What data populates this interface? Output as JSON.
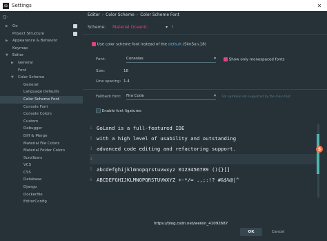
{
  "window": {
    "title": "Settings"
  },
  "sidebar": {
    "search_placeholder": "Q-",
    "items": [
      {
        "label": "Go",
        "indent": 0,
        "arrow": "▶",
        "gear": true
      },
      {
        "label": "Project Structure",
        "indent": 0,
        "arrow": "",
        "gear": true
      },
      {
        "label": "Appearance & Behavior",
        "indent": 0,
        "arrow": "▶",
        "gear": false
      },
      {
        "label": "Keymap",
        "indent": 0,
        "arrow": "",
        "gear": false
      },
      {
        "label": "Editor",
        "indent": 0,
        "arrow": "▼",
        "gear": false
      },
      {
        "label": "General",
        "indent": 1,
        "arrow": "▶",
        "gear": false
      },
      {
        "label": "Font",
        "indent": 1,
        "arrow": "",
        "gear": false
      },
      {
        "label": "Color Scheme",
        "indent": 1,
        "arrow": "▼",
        "gear": false
      },
      {
        "label": "General",
        "indent": 2,
        "arrow": "",
        "gear": false
      },
      {
        "label": "Language Defaults",
        "indent": 2,
        "arrow": "",
        "gear": false
      },
      {
        "label": "Color Scheme Font",
        "indent": 2,
        "arrow": "",
        "gear": false,
        "selected": true
      },
      {
        "label": "Console Font",
        "indent": 2,
        "arrow": "",
        "gear": false
      },
      {
        "label": "Console Colors",
        "indent": 2,
        "arrow": "",
        "gear": false
      },
      {
        "label": "Custom",
        "indent": 2,
        "arrow": "",
        "gear": false
      },
      {
        "label": "Debugger",
        "indent": 2,
        "arrow": "",
        "gear": false
      },
      {
        "label": "Diff & Merge",
        "indent": 2,
        "arrow": "",
        "gear": false
      },
      {
        "label": "Material File Colors",
        "indent": 2,
        "arrow": "",
        "gear": false
      },
      {
        "label": "Material Folder Colors",
        "indent": 2,
        "arrow": "",
        "gear": false
      },
      {
        "label": "Scrollbars",
        "indent": 2,
        "arrow": "",
        "gear": false
      },
      {
        "label": "VCS",
        "indent": 2,
        "arrow": "",
        "gear": false
      },
      {
        "label": "CSS",
        "indent": 2,
        "arrow": "",
        "gear": false
      },
      {
        "label": "Database",
        "indent": 2,
        "arrow": "",
        "gear": false
      },
      {
        "label": "Django",
        "indent": 2,
        "arrow": "",
        "gear": false
      },
      {
        "label": "Dockerfile",
        "indent": 2,
        "arrow": "",
        "gear": false
      },
      {
        "label": "EditorConfig",
        "indent": 2,
        "arrow": "",
        "gear": false
      }
    ]
  },
  "breadcrumb": [
    "Editor",
    "Color Scheme",
    "Color Scheme Font"
  ],
  "scheme": {
    "label": "Scheme:",
    "value": "Material Oceanic"
  },
  "use_font": {
    "text_before": "Use color scheme font instead of the",
    "link": "default",
    "text_after": "(SimSun,18)",
    "checked": true
  },
  "font": {
    "label": "Font:",
    "value": "Consolas"
  },
  "monospaced": {
    "label": "Show only monospaced fonts",
    "checked": true
  },
  "size": {
    "label": "Size:",
    "value": "18"
  },
  "line_spacing": {
    "label": "Line spacing:",
    "value": "1.4"
  },
  "fallback": {
    "label": "Fallback font:",
    "value": "Fira Code",
    "hint": "For symbols not supported by the main font"
  },
  "ligatures": {
    "label": "Enable font ligatures",
    "checked": false
  },
  "preview": [
    {
      "num": "1",
      "text": "GoLand is a full-featured IDE"
    },
    {
      "num": "2",
      "text": "with a high level of usability and outstanding"
    },
    {
      "num": "3",
      "text": "advanced code editing and refactoring support."
    },
    {
      "num": "4",
      "text": ""
    },
    {
      "num": "5",
      "text": "abcdefghijklmnopqrstuvwxyz 0123456789 (){}[]"
    },
    {
      "num": "6",
      "text": "ABCDEFGHIJKLMNOPQRSTUVWXYZ +-*/= .,;:!? #&$%@|^"
    }
  ],
  "buttons": {
    "ok": "OK",
    "cancel": "Cancel"
  },
  "watermark": "https://blog.csdn.net/weixin_41092687",
  "colors": {
    "accent": "#e0447a",
    "link": "#64b5f6",
    "background": "#263238"
  }
}
